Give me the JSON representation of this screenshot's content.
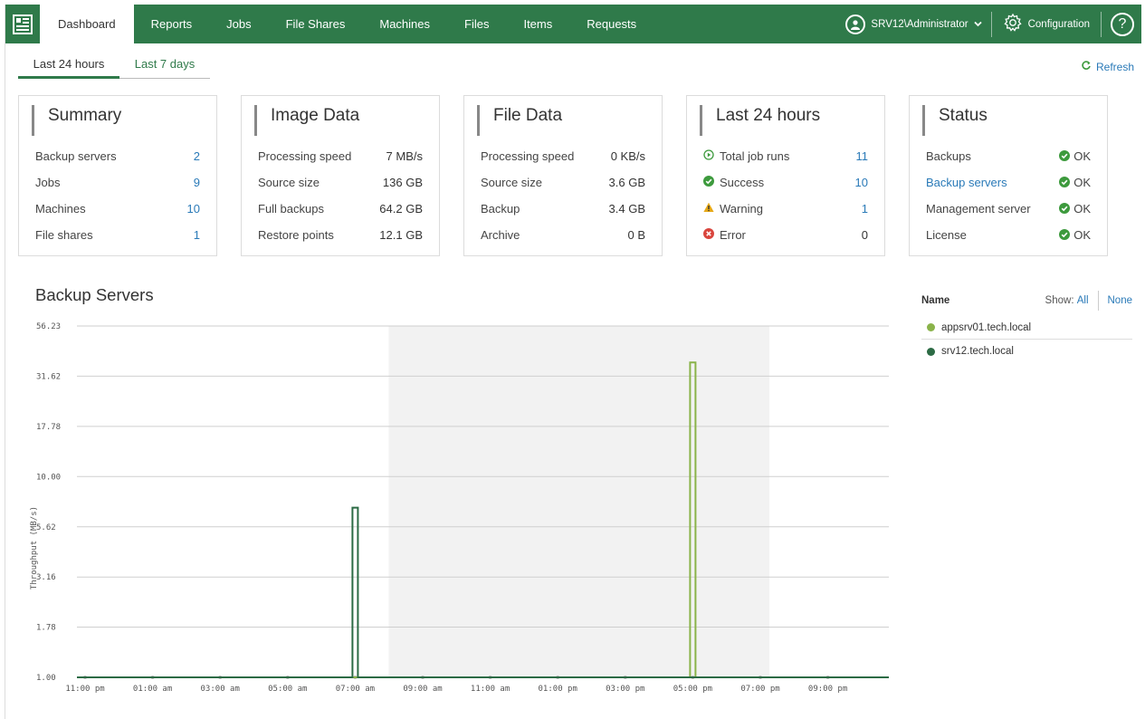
{
  "nav": {
    "tabs": [
      "Dashboard",
      "Reports",
      "Jobs",
      "File Shares",
      "Machines",
      "Files",
      "Items",
      "Requests"
    ],
    "active_tab": "Dashboard",
    "user": "SRV12\\Administrator",
    "config_label": "Configuration",
    "help_label": "?",
    "user_icon": "user-icon",
    "config_icon": "gear-icon"
  },
  "subtabs": {
    "t1": "Last 24 hours",
    "t2": "Last 7 days"
  },
  "refresh_label": "Refresh",
  "summary": {
    "title": "Summary",
    "rows": [
      {
        "label": "Backup servers",
        "value": "2"
      },
      {
        "label": "Jobs",
        "value": "9"
      },
      {
        "label": "Machines",
        "value": "10"
      },
      {
        "label": "File shares",
        "value": "1"
      }
    ]
  },
  "image_data": {
    "title": "Image Data",
    "rows": [
      {
        "label": "Processing speed",
        "value": "7 MB/s"
      },
      {
        "label": "Source size",
        "value": "136 GB"
      },
      {
        "label": "Full backups",
        "value": "64.2 GB"
      },
      {
        "label": "Restore points",
        "value": "12.1 GB"
      }
    ]
  },
  "file_data": {
    "title": "File Data",
    "rows": [
      {
        "label": "Processing speed",
        "value": "0 KB/s"
      },
      {
        "label": "Source size",
        "value": "3.6 GB"
      },
      {
        "label": "Backup",
        "value": "3.4 GB"
      },
      {
        "label": "Archive",
        "value": "0 B"
      }
    ]
  },
  "last24": {
    "title": "Last 24 hours",
    "rows": [
      {
        "label": "Total job runs",
        "value": "11",
        "icon": "play-circle-icon"
      },
      {
        "label": "Success",
        "value": "10",
        "icon": "check-circle-icon"
      },
      {
        "label": "Warning",
        "value": "1",
        "icon": "warning-icon"
      },
      {
        "label": "Error",
        "value": "0",
        "icon": "error-icon"
      }
    ]
  },
  "status": {
    "title": "Status",
    "rows": [
      {
        "label": "Backups",
        "value": "OK"
      },
      {
        "label": "Backup servers",
        "value": "OK"
      },
      {
        "label": "Management server",
        "value": "OK"
      },
      {
        "label": "License",
        "value": "OK"
      }
    ]
  },
  "colors": {
    "brand": "#2f7a4a",
    "link": "#2a7ab8",
    "ok": "#3d9a3d",
    "warning": "#e6a817",
    "error": "#d9453d",
    "series_app": "#8ab34a",
    "series_srv": "#2c6b45"
  },
  "chart_data": {
    "type": "line",
    "title": "Backup Servers",
    "ylabel": "Throughput (MB/s)",
    "yscale": "log",
    "y_ticks": [
      "56.23",
      "31.62",
      "17.78",
      "10.00",
      "5.62",
      "3.16",
      "1.78",
      "1.00"
    ],
    "x_ticks": [
      "11:00 pm",
      "01:00 am",
      "03:00 am",
      "05:00 am",
      "07:00 am",
      "09:00 am",
      "11:00 am",
      "01:00 pm",
      "03:00 pm",
      "05:00 pm",
      "07:00 pm",
      "09:00 pm"
    ],
    "ylim": [
      1,
      56.23
    ],
    "series": [
      {
        "name": "appsrv01.tech.local",
        "peak_time": "05:00 pm",
        "peak_value": 37
      },
      {
        "name": "srv12.tech.local",
        "peak_time": "07:00 am",
        "peak_value": 7
      }
    ],
    "legend": {
      "header": "Name",
      "show_label": "Show:",
      "all_label": "All",
      "none_label": "None"
    }
  }
}
